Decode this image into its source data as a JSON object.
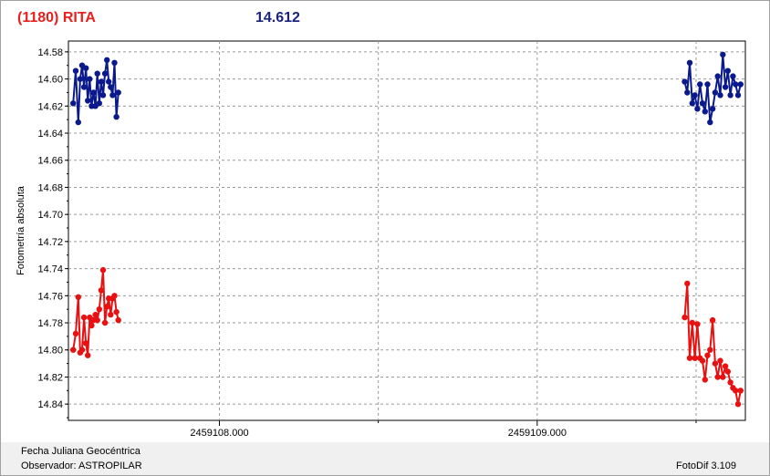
{
  "header": {
    "object": "(1180) RITA",
    "mean_mag": "14.612"
  },
  "footer": {
    "axis_label": "Fecha Juliana Geocéntrica",
    "observer": "Observador: ASTROPILAR",
    "software": "FotoDif 3.109"
  },
  "chart_data": {
    "type": "scatter",
    "ylabel": "Fotometría absoluta",
    "xlabel": "Fecha Juliana Geocéntrica",
    "x_ticks": [
      "2459108.000",
      "2459109.000"
    ],
    "y_ticks": [
      "14.58",
      "14.60",
      "14.62",
      "14.64",
      "14.66",
      "14.68",
      "14.70",
      "14.72",
      "14.74",
      "14.76",
      "14.78",
      "14.80",
      "14.82",
      "14.84"
    ],
    "xlim": [
      2459107.525,
      2459109.655
    ],
    "ylim": [
      14.572,
      14.852
    ],
    "y_inverted": true,
    "grid": true,
    "series": [
      {
        "color": "#0a1a8c",
        "x": [
          2459107.54,
          2459107.548,
          2459107.556,
          2459107.562,
          2459107.568,
          2459107.574,
          2459107.58,
          2459107.586,
          2459107.592,
          2459107.598,
          2459107.604,
          2459107.61,
          2459107.616,
          2459107.622,
          2459107.628,
          2459107.634,
          2459107.64,
          2459107.646,
          2459107.652,
          2459107.658,
          2459107.664,
          2459107.67,
          2459107.676,
          2459107.682,
          2459109.464,
          2459109.472,
          2459109.48,
          2459109.488,
          2459109.496,
          2459109.504,
          2459109.512,
          2459109.52,
          2459109.528,
          2459109.536,
          2459109.544,
          2459109.552,
          2459109.56,
          2459109.568,
          2459109.576,
          2459109.584,
          2459109.592,
          2459109.6,
          2459109.608,
          2459109.616,
          2459109.624,
          2459109.632,
          2459109.64
        ],
        "y": [
          14.618,
          14.594,
          14.632,
          14.6,
          14.59,
          14.606,
          14.592,
          14.616,
          14.6,
          14.62,
          14.61,
          14.62,
          14.596,
          14.618,
          14.602,
          14.612,
          14.596,
          14.586,
          14.602,
          14.606,
          14.612,
          14.588,
          14.628,
          14.61,
          14.602,
          14.61,
          14.588,
          14.618,
          14.612,
          14.622,
          14.604,
          14.618,
          14.624,
          14.604,
          14.632,
          14.622,
          14.61,
          14.598,
          14.612,
          14.582,
          14.606,
          14.594,
          14.612,
          14.598,
          14.604,
          14.612,
          14.604
        ]
      },
      {
        "color": "#e81010",
        "x": [
          2459107.54,
          2459107.548,
          2459107.556,
          2459107.562,
          2459107.568,
          2459107.574,
          2459107.58,
          2459107.586,
          2459107.592,
          2459107.598,
          2459107.604,
          2459107.61,
          2459107.616,
          2459107.622,
          2459107.628,
          2459107.634,
          2459107.64,
          2459107.646,
          2459107.652,
          2459107.658,
          2459107.664,
          2459107.67,
          2459107.676,
          2459107.682,
          2459109.464,
          2459109.472,
          2459109.48,
          2459109.488,
          2459109.496,
          2459109.504,
          2459109.512,
          2459109.52,
          2459109.528,
          2459109.536,
          2459109.544,
          2459109.552,
          2459109.56,
          2459109.568,
          2459109.576,
          2459109.584,
          2459109.592,
          2459109.6,
          2459109.608,
          2459109.616,
          2459109.624,
          2459109.632,
          2459109.64
        ],
        "y": [
          14.8,
          14.788,
          14.761,
          14.802,
          14.8,
          14.776,
          14.795,
          14.804,
          14.776,
          14.782,
          14.778,
          14.774,
          14.778,
          14.77,
          14.756,
          14.741,
          14.78,
          14.768,
          14.762,
          14.774,
          14.762,
          14.76,
          14.772,
          14.778,
          14.776,
          14.751,
          14.806,
          14.78,
          14.806,
          14.781,
          14.806,
          14.808,
          14.822,
          14.804,
          14.8,
          14.778,
          14.81,
          14.82,
          14.808,
          14.82,
          14.812,
          14.816,
          14.824,
          14.828,
          14.83,
          14.84,
          14.83
        ]
      }
    ]
  }
}
